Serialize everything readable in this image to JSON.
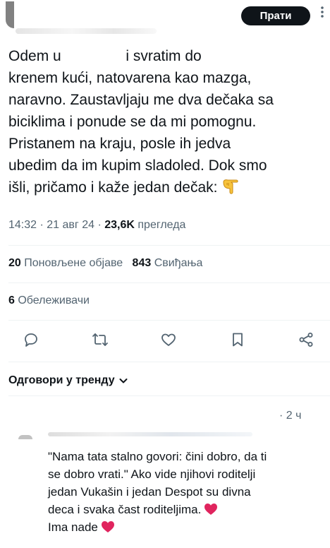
{
  "header": {
    "follow_label": "Прати",
    "more_label": "⋮"
  },
  "post": {
    "lines": [
      [
        "Odem u ",
        " i svratim do"
      ],
      "krenem kući,  natovarena kao mazga,",
      "naravno. Zaustavljaju me dva dečaka sa",
      "biciklima i ponude se da mi pomognu.",
      "Pristanem na kraju, posle ih jedva",
      "ubedim da im kupim sladoled. Dok smo",
      "išli, pričamo i kaže jedan dečak:"
    ],
    "emoji": "backhand-index-pointing-down"
  },
  "meta": {
    "time": "14:32",
    "date": "21 авг 24",
    "views_count": "23,6K",
    "views_label": "прегледа"
  },
  "stats": {
    "reposts_count": "20",
    "reposts_label": "Поновљене објаве",
    "likes_count": "843",
    "likes_label": "Свиђања",
    "bookmarks_count": "6",
    "bookmarks_label": "Обележивачи"
  },
  "actions": [
    "reply-icon",
    "repost-icon",
    "like-icon",
    "bookmark-icon",
    "share-icon"
  ],
  "replies": {
    "sort_label": "Одговори у тренду",
    "first": {
      "time": "· 2 ч",
      "lines": [
        "\"Nama tata stalno govori: čini dobro, da ti",
        "se dobro vrati.\" Ako vide njihovi roditelji",
        "jedan Vukašin i jedan Despot su divna",
        "deca i svaka čast roditeljima.",
        "Ima nade"
      ],
      "emoji": "red-heart"
    }
  },
  "colors": {
    "text": "#0f1419",
    "secondary": "#536471",
    "divider": "#eff3f4",
    "heart": "#e0245e"
  }
}
